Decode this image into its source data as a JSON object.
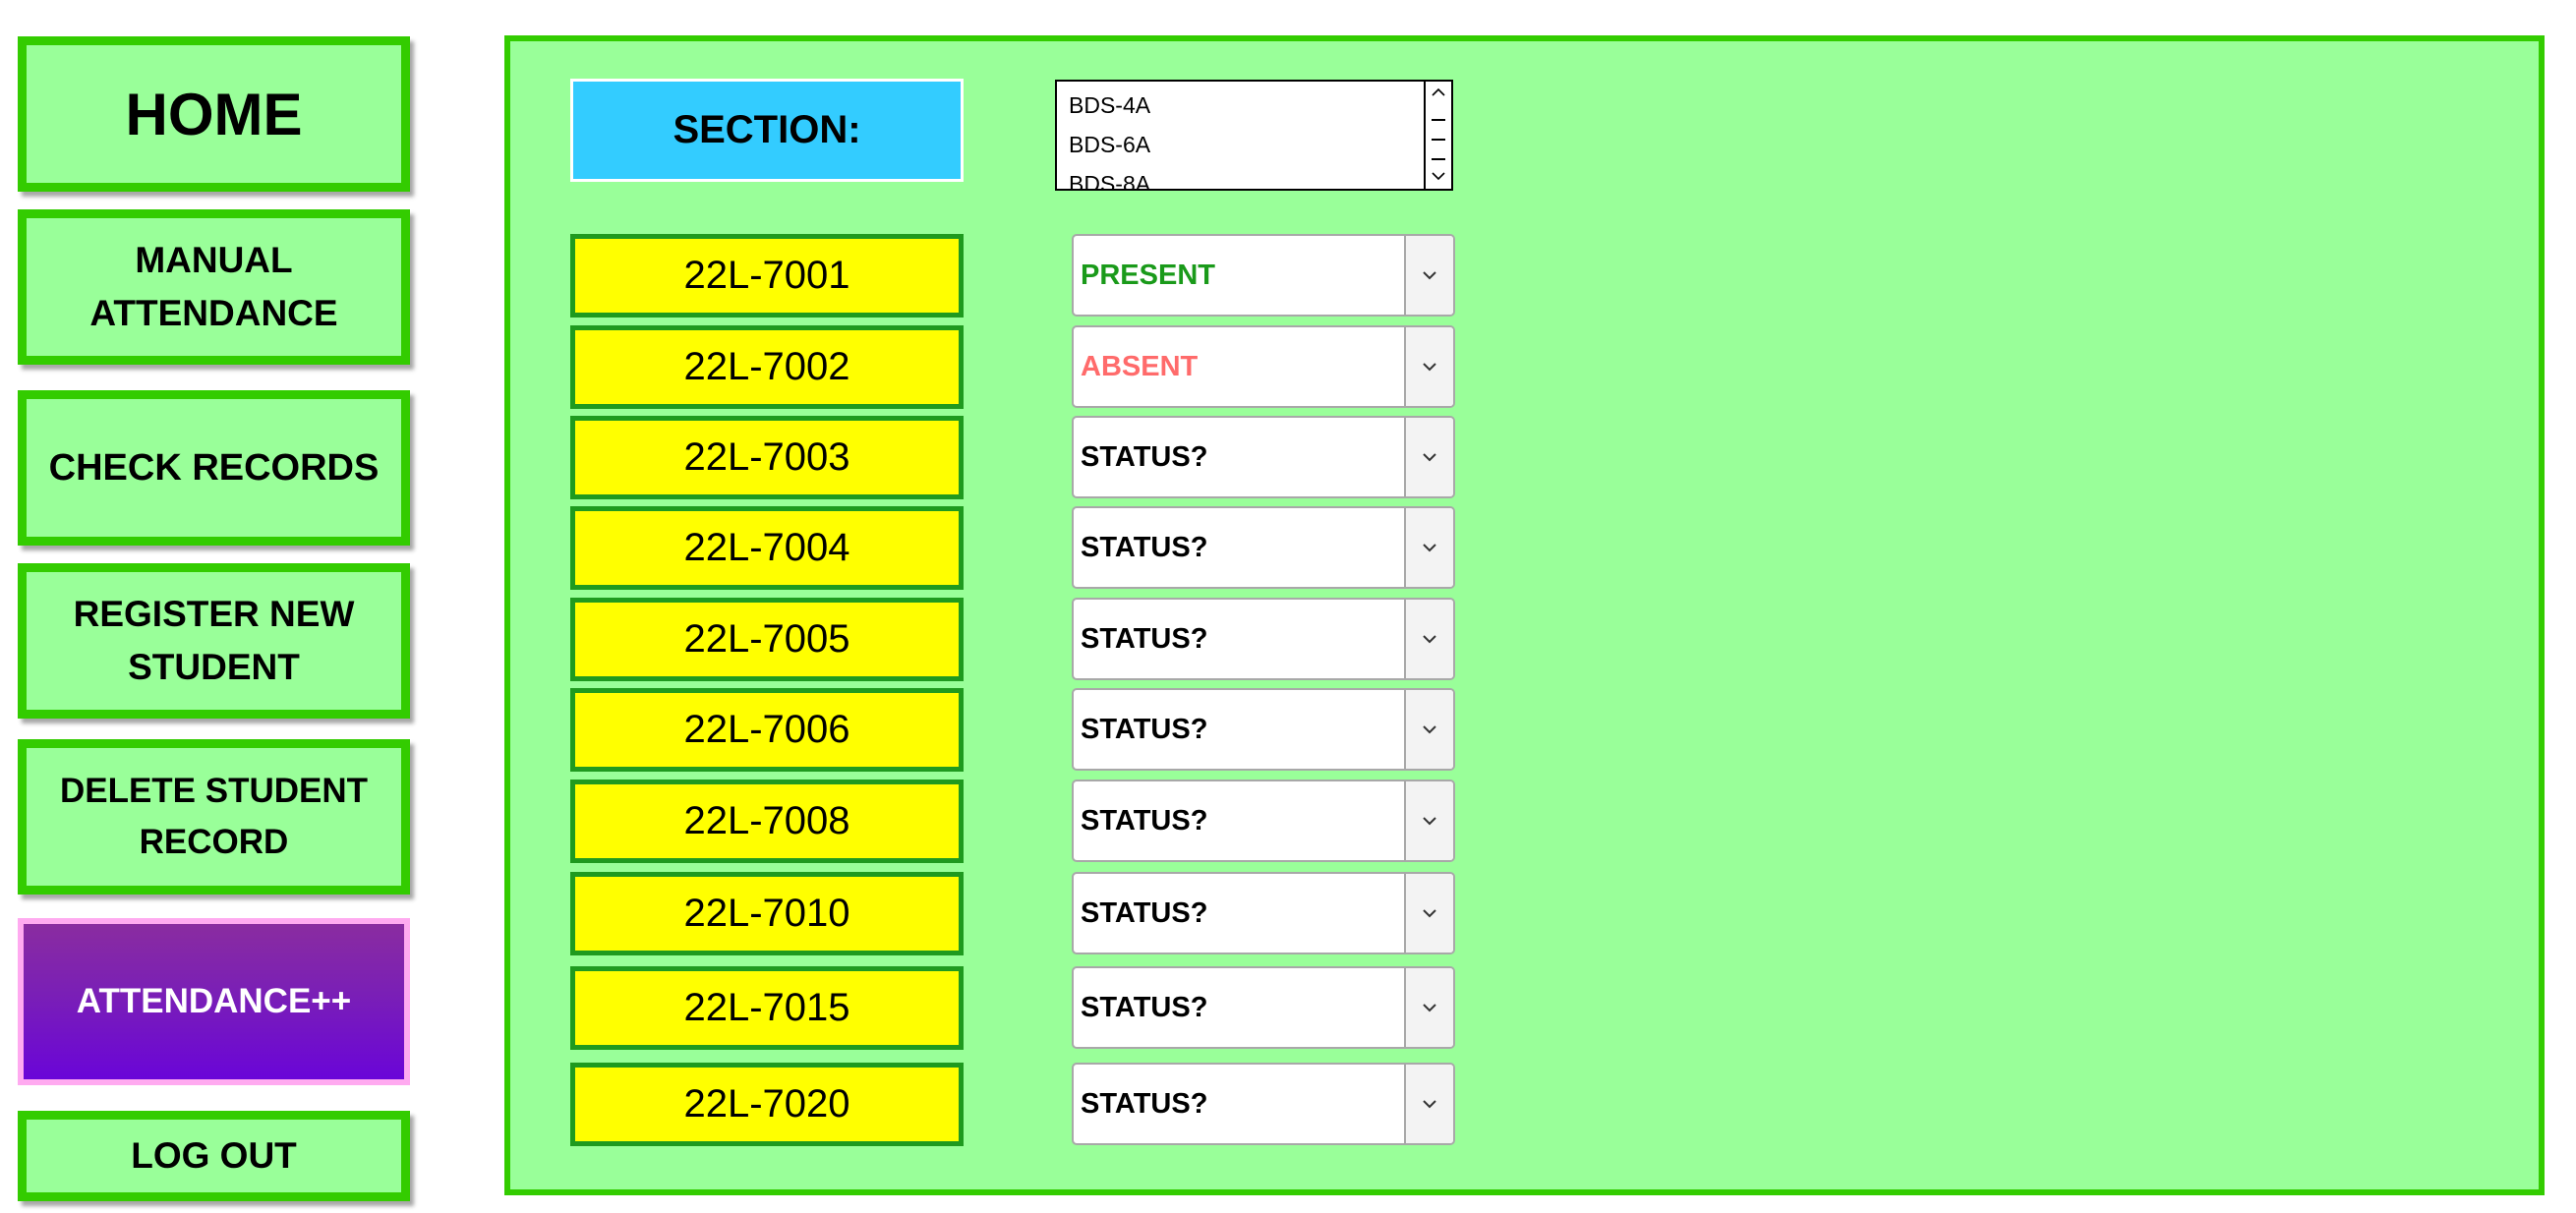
{
  "sidebar": {
    "home": "HOME",
    "manual_attendance": "MANUAL\nATTENDANCE",
    "check_records": "CHECK RECORDS",
    "register_new_student": "REGISTER NEW\nSTUDENT",
    "delete_student_record": "DELETE STUDENT\nRECORD",
    "attendance_plus": "ATTENDANCE++",
    "log_out": "LOG OUT"
  },
  "main": {
    "section_label": "SECTION:",
    "section_options": [
      "BDS-4A",
      "BDS-6A",
      "BDS-8A"
    ],
    "students": [
      {
        "id": "22L-7001",
        "status": "PRESENT"
      },
      {
        "id": "22L-7002",
        "status": "ABSENT"
      },
      {
        "id": "22L-7003",
        "status": "STATUS?"
      },
      {
        "id": "22L-7004",
        "status": "STATUS?"
      },
      {
        "id": "22L-7005",
        "status": "STATUS?"
      },
      {
        "id": "22L-7006",
        "status": "STATUS?"
      },
      {
        "id": "22L-7008",
        "status": "STATUS?"
      },
      {
        "id": "22L-7010",
        "status": "STATUS?"
      },
      {
        "id": "22L-7015",
        "status": "STATUS?"
      },
      {
        "id": "22L-7020",
        "status": "STATUS?"
      }
    ]
  },
  "colors": {
    "panel_bg": "#99ff99",
    "panel_border": "#33cc00",
    "section_label_bg": "#33ccff",
    "id_bg": "#ffff00",
    "id_border": "#1f9a1f",
    "present": "#1a9a1a",
    "absent": "#ff6b6b",
    "accent_purple": "#7a1fb6"
  }
}
